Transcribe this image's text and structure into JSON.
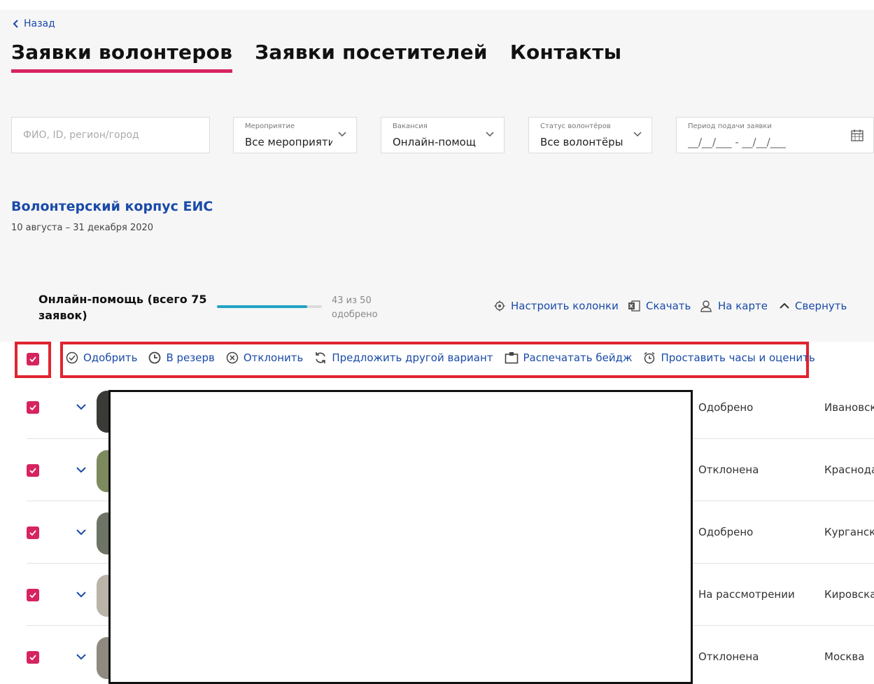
{
  "nav": {
    "back_label": "Назад"
  },
  "tabs": [
    {
      "label": "Заявки волонтеров",
      "active": true
    },
    {
      "label": "Заявки посетителей",
      "active": false
    },
    {
      "label": "Контакты",
      "active": false
    }
  ],
  "filters": {
    "search_placeholder": "ФИО, ID, регион/город",
    "event": {
      "label": "Мероприятие",
      "value": "Все мероприяти"
    },
    "vacancy": {
      "label": "Вакансия",
      "value": "Онлайн-помощ"
    },
    "status": {
      "label": "Статус волонтёров",
      "value": "Все волонтёры"
    },
    "period": {
      "label": "Период подачи заявки",
      "value": "__/__/___ - __/__/___"
    }
  },
  "event": {
    "title": "Волонтерский корпус ЕИС",
    "dates": "10 августа – 31 декабря 2020"
  },
  "vacancy_block": {
    "title": "Онлайн-помощь (всего 75 заявок)",
    "progress_text": "43 из 50 одобрено",
    "progress_fraction": 0.86,
    "actions": {
      "columns": "Настроить колонки",
      "download": "Скачать",
      "map": "На карте",
      "collapse": "Свернуть"
    }
  },
  "bulk_actions": {
    "approve": "Одобрить",
    "reserve": "В резерв",
    "reject": "Отклонить",
    "suggest": "Предложить другой вариант",
    "badge": "Распечатать бейдж",
    "hours": "Проставить часы и оценить"
  },
  "rows": [
    {
      "status": "Одобрено",
      "region": "Ивановск"
    },
    {
      "status": "Отклонена",
      "region": "Краснода"
    },
    {
      "status": "Одобрено",
      "region": "Курганск"
    },
    {
      "status": "На рассмотрении",
      "region": "Кировска"
    },
    {
      "status": "Отклонена",
      "region": "Москва"
    }
  ],
  "colors": {
    "accent": "#d6245e",
    "link": "#1a4aa8",
    "highlight": "#e0242f",
    "progress": "#22a3c4"
  }
}
